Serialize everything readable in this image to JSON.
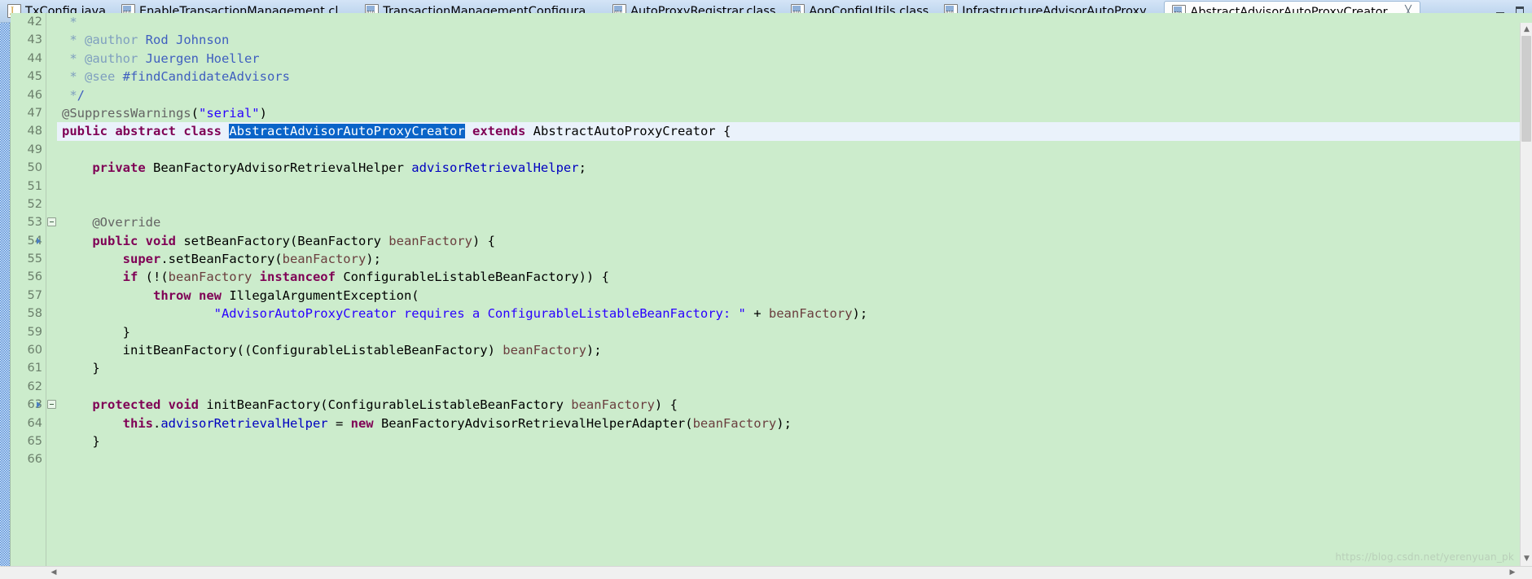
{
  "window": {
    "minimize_label": "—",
    "maximize_label": "❐"
  },
  "tabs": [
    {
      "label": "TxConfig.java",
      "icon": "java-file-icon",
      "active": false,
      "closable": false
    },
    {
      "label": "EnableTransactionManagement.cl...",
      "icon": "class-file-icon",
      "active": false,
      "closable": false
    },
    {
      "label": "TransactionManagementConfigura...",
      "icon": "class-file-icon",
      "active": false,
      "closable": false
    },
    {
      "label": "AutoProxyRegistrar.class",
      "icon": "class-file-icon",
      "active": false,
      "closable": false
    },
    {
      "label": "AopConfigUtils.class",
      "icon": "class-file-icon",
      "active": false,
      "closable": false
    },
    {
      "label": "InfrastructureAdvisorAutoProxy...",
      "icon": "class-file-icon",
      "active": false,
      "closable": false
    },
    {
      "label": "AbstractAdvisorAutoProxyCreator...",
      "icon": "class-file-icon",
      "active": true,
      "closable": true,
      "close_label": "╳"
    }
  ],
  "editor": {
    "first_visible_line": 42,
    "current_line": 48,
    "selected_text": "AbstractAdvisorAutoProxyCreator",
    "line_numbers": [
      "42",
      "43",
      "44",
      "45",
      "46",
      "47",
      "48",
      "49",
      "50",
      "51",
      "52",
      "53",
      "54",
      "55",
      "56",
      "57",
      "58",
      "59",
      "60",
      "61",
      "62",
      "63",
      "64",
      "65",
      "66"
    ],
    "lines": [
      {
        "n": "42",
        "text": " *"
      },
      {
        "n": "43",
        "text": " * @author Rod Johnson"
      },
      {
        "n": "44",
        "text": " * @author Juergen Hoeller"
      },
      {
        "n": "45",
        "text": " * @see #findCandidateAdvisors"
      },
      {
        "n": "46",
        "text": " */"
      },
      {
        "n": "47",
        "text": "@SuppressWarnings(\"serial\")"
      },
      {
        "n": "48",
        "text": "public abstract class AbstractAdvisorAutoProxyCreator extends AbstractAutoProxyCreator {"
      },
      {
        "n": "49",
        "text": ""
      },
      {
        "n": "50",
        "text": "    private BeanFactoryAdvisorRetrievalHelper advisorRetrievalHelper;"
      },
      {
        "n": "51",
        "text": ""
      },
      {
        "n": "52",
        "text": ""
      },
      {
        "n": "53",
        "text": "    @Override"
      },
      {
        "n": "54",
        "text": "    public void setBeanFactory(BeanFactory beanFactory) {"
      },
      {
        "n": "55",
        "text": "        super.setBeanFactory(beanFactory);"
      },
      {
        "n": "56",
        "text": "        if (!(beanFactory instanceof ConfigurableListableBeanFactory)) {"
      },
      {
        "n": "57",
        "text": "            throw new IllegalArgumentException("
      },
      {
        "n": "58",
        "text": "                    \"AdvisorAutoProxyCreator requires a ConfigurableListableBeanFactory: \" + beanFactory);"
      },
      {
        "n": "59",
        "text": "        }"
      },
      {
        "n": "60",
        "text": "        initBeanFactory((ConfigurableListableBeanFactory) beanFactory);"
      },
      {
        "n": "61",
        "text": "    }"
      },
      {
        "n": "62",
        "text": ""
      },
      {
        "n": "63",
        "text": "    protected void initBeanFactory(ConfigurableListableBeanFactory beanFactory) {"
      },
      {
        "n": "64",
        "text": "        this.advisorRetrievalHelper = new BeanFactoryAdvisorRetrievalHelperAdapter(beanFactory);"
      },
      {
        "n": "65",
        "text": "    }"
      },
      {
        "n": "66",
        "text": ""
      }
    ],
    "fold_marker_lines": [
      "53",
      "63"
    ],
    "override_marker_lines": [
      "54",
      "63"
    ],
    "scroll_up_arrow": "▲",
    "scroll_down_arrow": "▼",
    "scroll_left_arrow": "◀",
    "scroll_right_arrow": "▶"
  },
  "watermark": "https://blog.csdn.net/yerenyuan_pk",
  "colors": {
    "editor_background": "#cceccc",
    "current_line_background": "#eaf2fb",
    "selection_background": "#0a64c8",
    "keyword": "#7f0055",
    "string": "#2a00ff",
    "comment": "#3f5fbf",
    "comment_tag": "#7f9fbf",
    "field": "#0000c0",
    "parameter": "#6a3e3e",
    "annotation": "#646464",
    "line_number": "#6b7f6b",
    "tabbar": "#c3d9f0"
  }
}
